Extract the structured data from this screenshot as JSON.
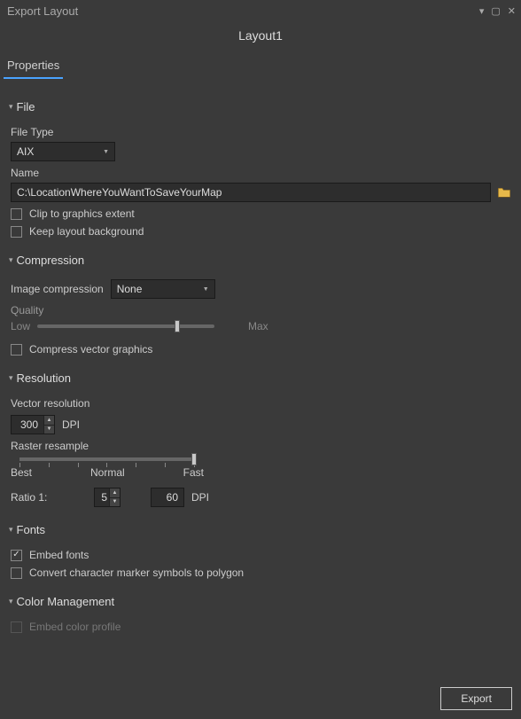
{
  "window": {
    "title": "Export Layout",
    "subtitle": "Layout1"
  },
  "tabs": {
    "properties": "Properties"
  },
  "file": {
    "header": "File",
    "file_type_label": "File Type",
    "file_type_value": "AIX",
    "name_label": "Name",
    "name_value": "C:\\LocationWhereYouWantToSaveYourMap",
    "clip_label": "Clip to graphics extent",
    "clip_checked": false,
    "keep_bg_label": "Keep layout background",
    "keep_bg_checked": false
  },
  "compression": {
    "header": "Compression",
    "image_comp_label": "Image compression",
    "image_comp_value": "None",
    "quality_label": "Quality",
    "quality_low": "Low",
    "quality_max": "Max",
    "compress_vector_label": "Compress vector graphics",
    "compress_vector_checked": false
  },
  "resolution": {
    "header": "Resolution",
    "vector_label": "Vector resolution",
    "vector_value": "300",
    "dpi": "DPI",
    "raster_label": "Raster resample",
    "best": "Best",
    "normal": "Normal",
    "fast": "Fast",
    "ratio_label": "Ratio 1:",
    "ratio_value": "5",
    "ratio_result": "60"
  },
  "fonts": {
    "header": "Fonts",
    "embed_label": "Embed fonts",
    "embed_checked": true,
    "convert_label": "Convert character marker symbols to polygon",
    "convert_checked": false
  },
  "color": {
    "header": "Color Management",
    "embed_profile_label": "Embed color profile",
    "embed_profile_checked": false
  },
  "footer": {
    "export": "Export"
  }
}
